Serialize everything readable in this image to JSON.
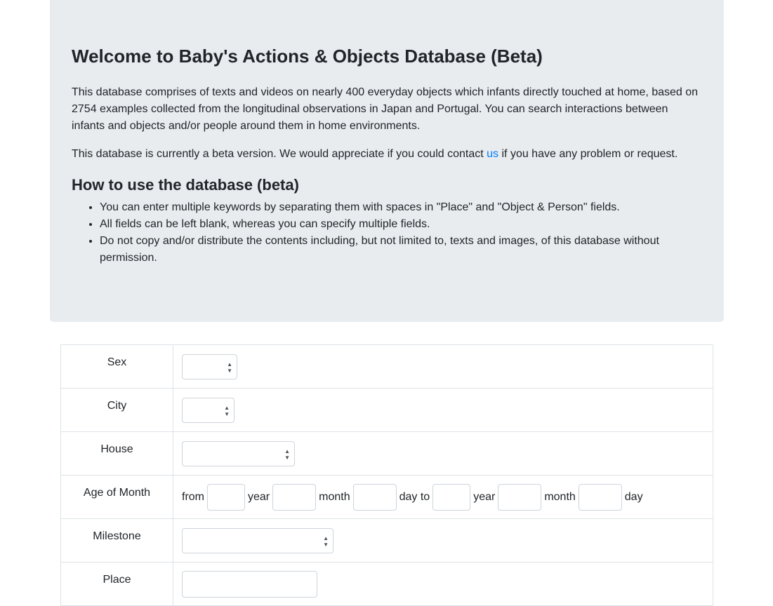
{
  "header": {
    "title": "Welcome to Baby's Actions & Objects Database (Beta)",
    "intro": "This database comprises of texts and videos on nearly 400 everyday objects which infants directly touched at home, based on 2754 examples collected from the longitudinal observations in Japan and Portugal. You can search interactions between infants and objects and/or people around them in home environments.",
    "beta_prefix": "This database is currently a beta version. We would appreciate if you could contact ",
    "beta_link": "us",
    "beta_suffix": " if you have any problem or request.",
    "howto_title": "How to use the database (beta)",
    "howto_items": [
      "You can enter multiple keywords by separating them with spaces in \"Place\" and \"Object & Person\" fields.",
      "All fields can be left blank, whereas you can specify multiple fields.",
      "Do not copy and/or distribute the contents including, but not limited to, texts and images, of this database without permission."
    ]
  },
  "form": {
    "sex_label": "Sex",
    "city_label": "City",
    "house_label": "House",
    "age_label": "Age of Month",
    "age_words": {
      "from": "from",
      "year": "year",
      "month": "month",
      "day_to": "day to",
      "day": "day"
    },
    "milestone_label": "Milestone",
    "place_label": "Place"
  }
}
